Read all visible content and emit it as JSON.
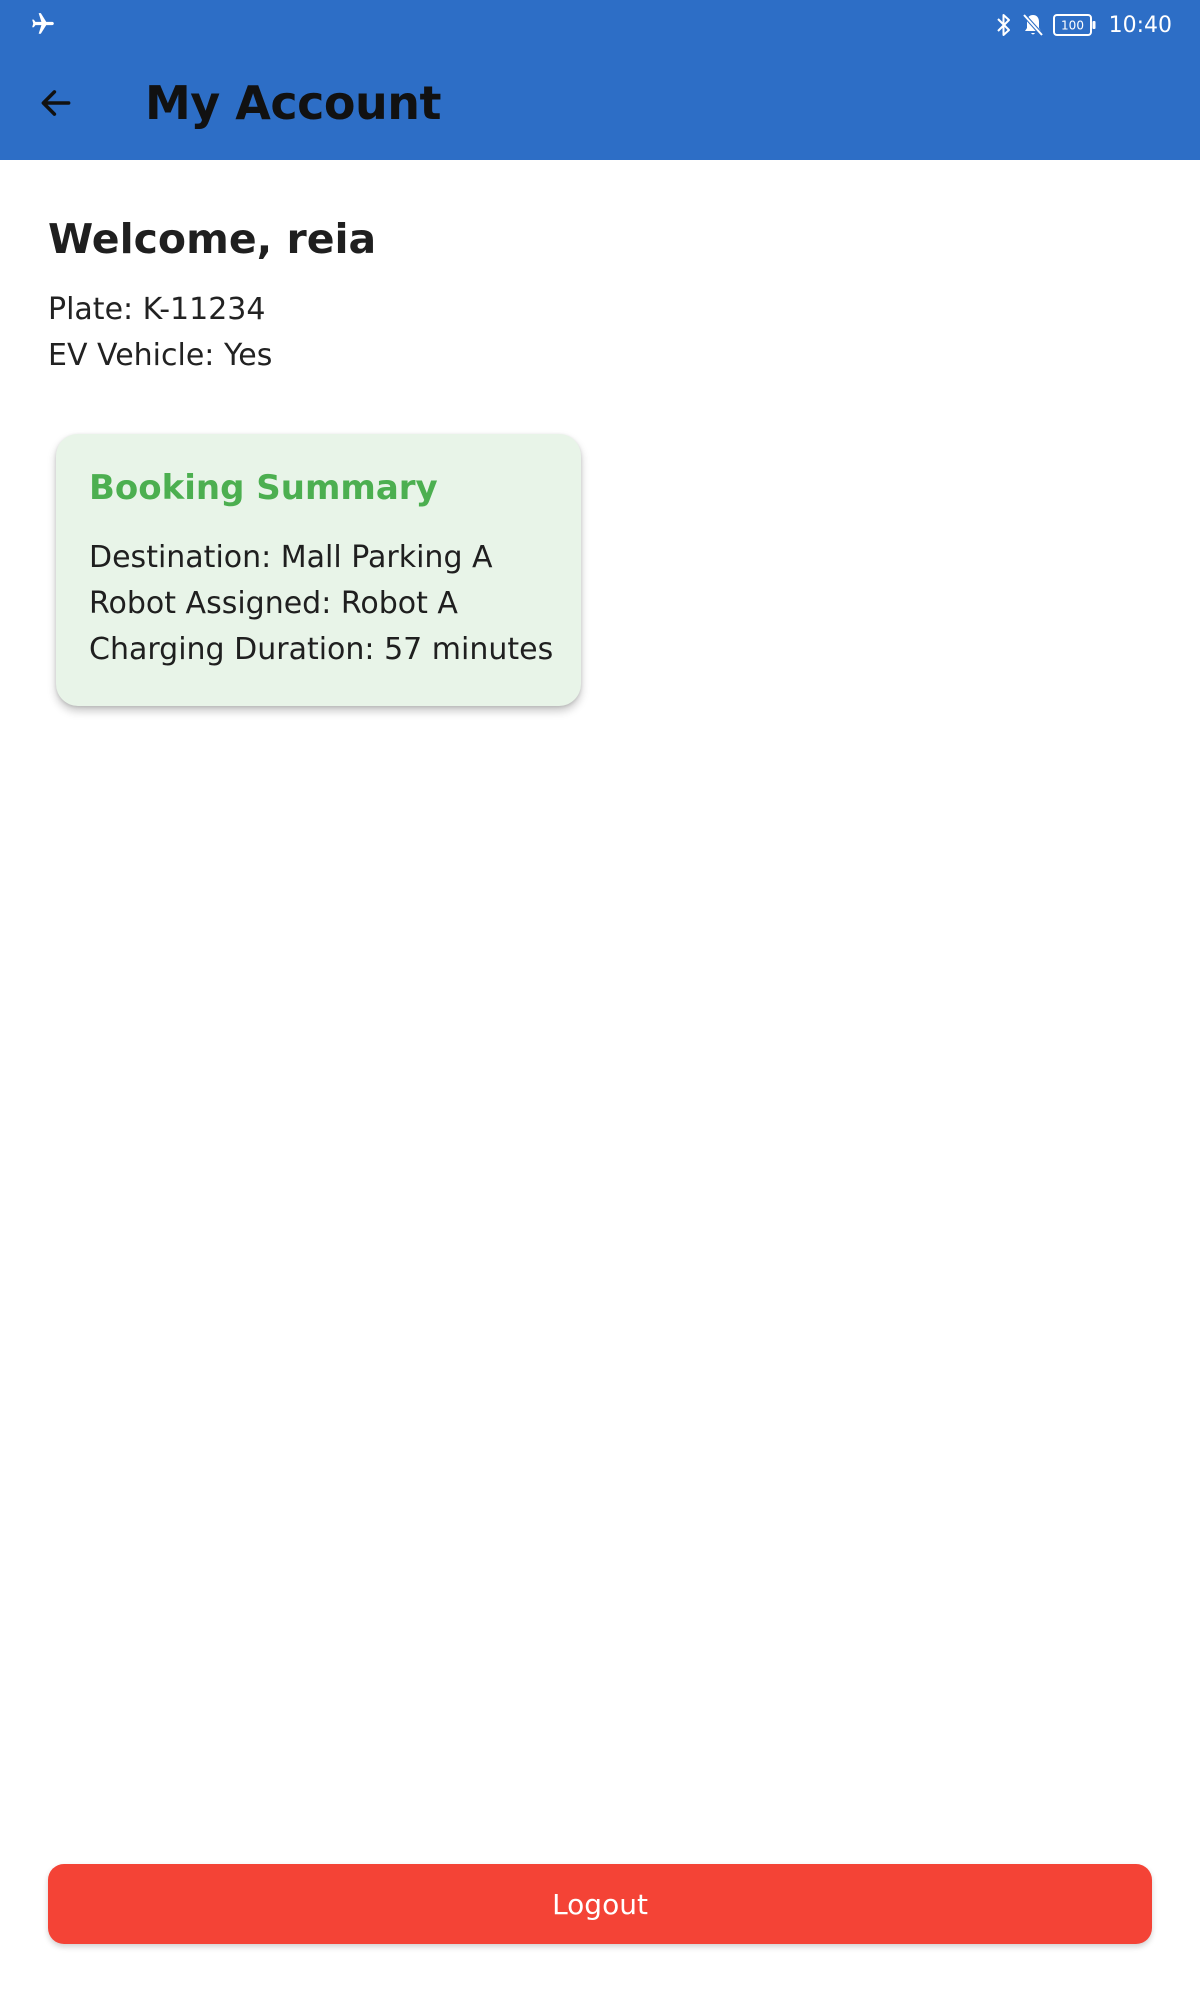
{
  "status_bar": {
    "time": "10:40",
    "battery": "100",
    "icons": [
      "airplane-mode-icon",
      "bluetooth-icon",
      "notifications-off-icon",
      "battery-icon"
    ]
  },
  "header": {
    "title": "My Account",
    "back_icon": "arrow-left-icon",
    "background_color": "#2d6ec6"
  },
  "account": {
    "welcome": "Welcome, reia",
    "plate": "Plate: K-11234",
    "ev_vehicle": "EV Vehicle: Yes"
  },
  "booking_summary": {
    "title": "Booking Summary",
    "destination": "Destination: Mall Parking A",
    "robot": "Robot Assigned: Robot A",
    "duration": "Charging Duration: 57 minutes",
    "title_color": "#4caf50",
    "background_color": "#e8f4e8"
  },
  "actions": {
    "logout_label": "Logout",
    "logout_color": "#f44336"
  }
}
